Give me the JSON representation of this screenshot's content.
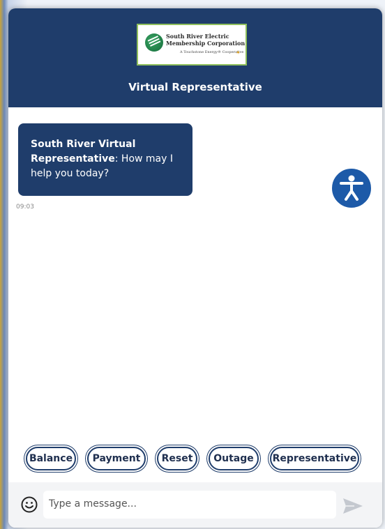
{
  "header": {
    "logo_line1": "South River Electric",
    "logo_line2": "Membership Corporation",
    "logo_line3": "A Touchstone Energy® Cooperative",
    "title": "Virtual Representative"
  },
  "chat": {
    "messages": [
      {
        "sender": "South River Virtual Representative",
        "text": ": How may I help you today?",
        "time": "09:03"
      }
    ]
  },
  "accessibility": {
    "icon": "accessibility-icon"
  },
  "quick_replies": [
    {
      "label": "Balance"
    },
    {
      "label": "Payment"
    },
    {
      "label": "Reset"
    },
    {
      "label": "Outage"
    },
    {
      "label": "Representative"
    }
  ],
  "composer": {
    "placeholder": "Type a message...",
    "value": "",
    "emoji_icon": "smiley-icon",
    "send_icon": "send-icon"
  },
  "colors": {
    "primary": "#1f3d6b",
    "accessibility": "#1d5aa8",
    "background": "#ffffff",
    "input_bar": "#f3f4f6"
  }
}
